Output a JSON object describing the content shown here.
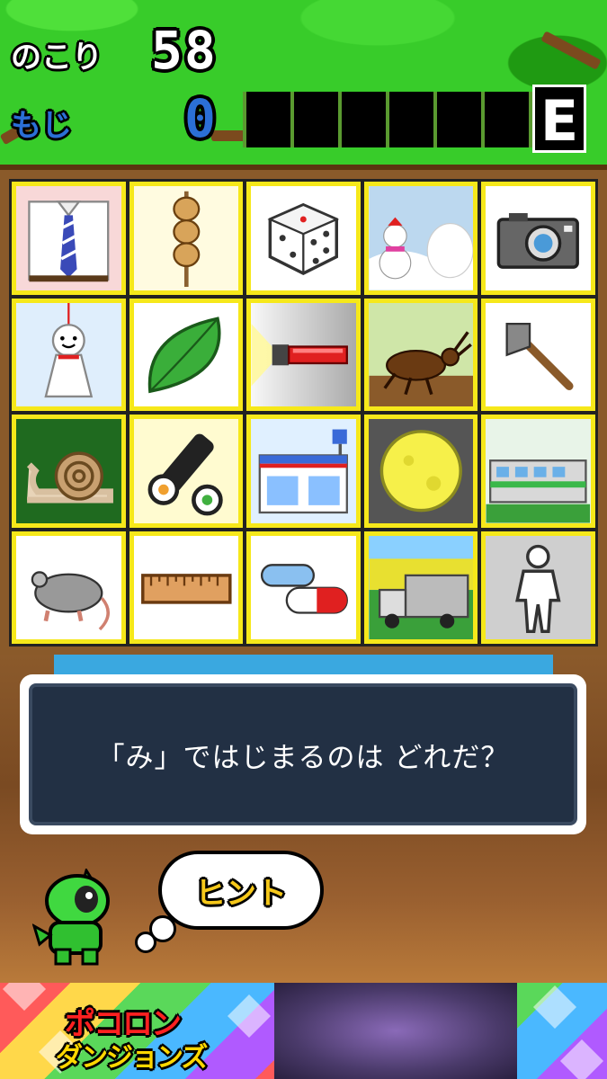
{
  "status": {
    "remaining_label": "のこり",
    "remaining_value": "58",
    "letters_label": "もじ",
    "letters_value": "0",
    "letter_slots": 6,
    "rank": "E"
  },
  "board": {
    "tiles": [
      {
        "icon": "shirt-tie-icon"
      },
      {
        "icon": "dango-icon"
      },
      {
        "icon": "dice-icon"
      },
      {
        "icon": "snowman-icon"
      },
      {
        "icon": "camera-icon"
      },
      {
        "icon": "teru-teru-bozu-icon"
      },
      {
        "icon": "leaf-icon"
      },
      {
        "icon": "flashlight-icon"
      },
      {
        "icon": "beetle-icon"
      },
      {
        "icon": "axe-icon"
      },
      {
        "icon": "snail-icon"
      },
      {
        "icon": "sushi-roll-icon"
      },
      {
        "icon": "convenience-store-icon"
      },
      {
        "icon": "full-moon-icon"
      },
      {
        "icon": "train-icon"
      },
      {
        "icon": "mouse-icon"
      },
      {
        "icon": "ruler-icon"
      },
      {
        "icon": "capsule-pill-icon"
      },
      {
        "icon": "truck-icon"
      },
      {
        "icon": "person-figure-icon"
      }
    ]
  },
  "question": {
    "text": "「み」ではじまるのは どれだ？"
  },
  "hint": {
    "label": "ヒント"
  },
  "ad": {
    "logo_top": "ポコロン",
    "logo_bottom": "ダンジョンズ"
  },
  "colors": {
    "tile_border": "#f6e81a",
    "grass": "#38cc2a",
    "wood": "#8a5a2a",
    "question_bg": "#223044",
    "letters_blue": "#2b6fd6"
  }
}
